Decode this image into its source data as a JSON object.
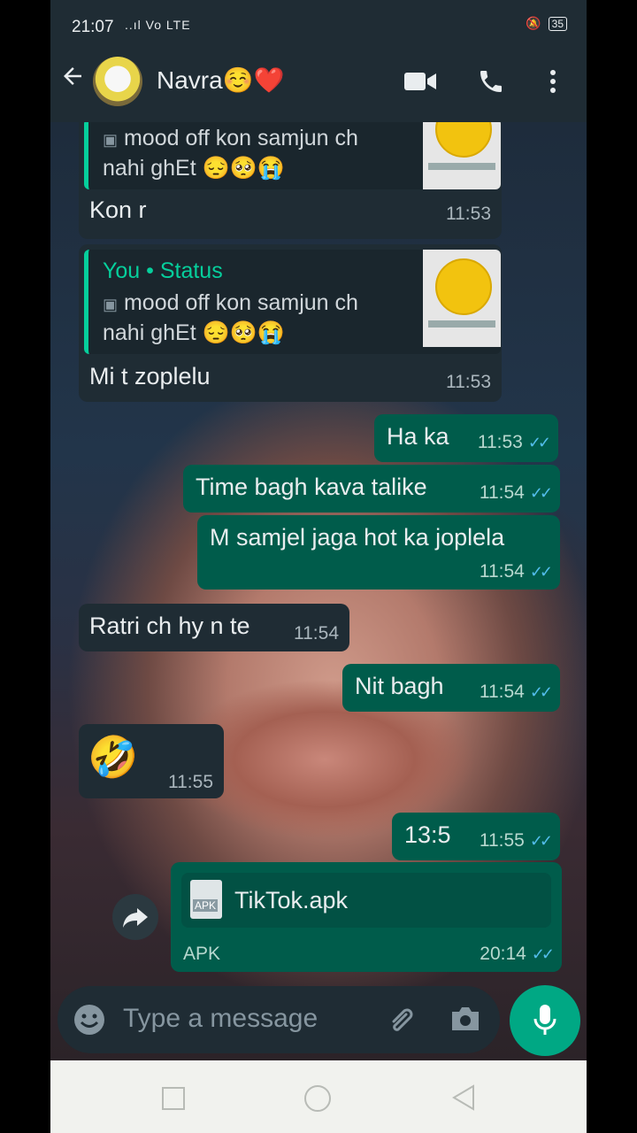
{
  "status_bar": {
    "time": "21:07",
    "signal": "..ıl",
    "network": "Vo LTE",
    "battery": "35"
  },
  "header": {
    "contact_name": "Navra☺️❤️"
  },
  "messages": [
    {
      "dir": "in",
      "quote_text_line1": "mood off kon samjun ch",
      "quote_text_line2": "nahi ghEt 😔🥺😭",
      "text": "Kon r",
      "time": "11:53"
    },
    {
      "dir": "in",
      "quote_title": "You • Status",
      "quote_text_line1": "mood off kon samjun ch",
      "quote_text_line2": "nahi ghEt 😔🥺😭",
      "text": "Mi t zoplelu",
      "time": "11:53"
    },
    {
      "dir": "out",
      "text": "Ha ka",
      "time": "11:53"
    },
    {
      "dir": "out",
      "text": "Time bagh kava talike",
      "time": "11:54"
    },
    {
      "dir": "out",
      "text": "M samjel jaga hot ka joplela",
      "time": "11:54"
    },
    {
      "dir": "in",
      "text": "Ratri ch hy n te",
      "time": "11:54"
    },
    {
      "dir": "out",
      "text": "Nit bagh",
      "time": "11:54"
    },
    {
      "dir": "in",
      "text": "🤣",
      "time": "11:55"
    },
    {
      "dir": "out",
      "text": "13:5",
      "time": "11:55"
    },
    {
      "dir": "out",
      "file_name": "TikTok.apk",
      "file_icon_label": "APK",
      "file_type": "APK",
      "time": "20:14"
    }
  ],
  "composer": {
    "placeholder": "Type a message"
  },
  "colors": {
    "header": "#1f2c34",
    "incoming": "#1f2c34",
    "outgoing": "#005c4b",
    "accent": "#00a884",
    "ticks": "#53bdeb"
  }
}
